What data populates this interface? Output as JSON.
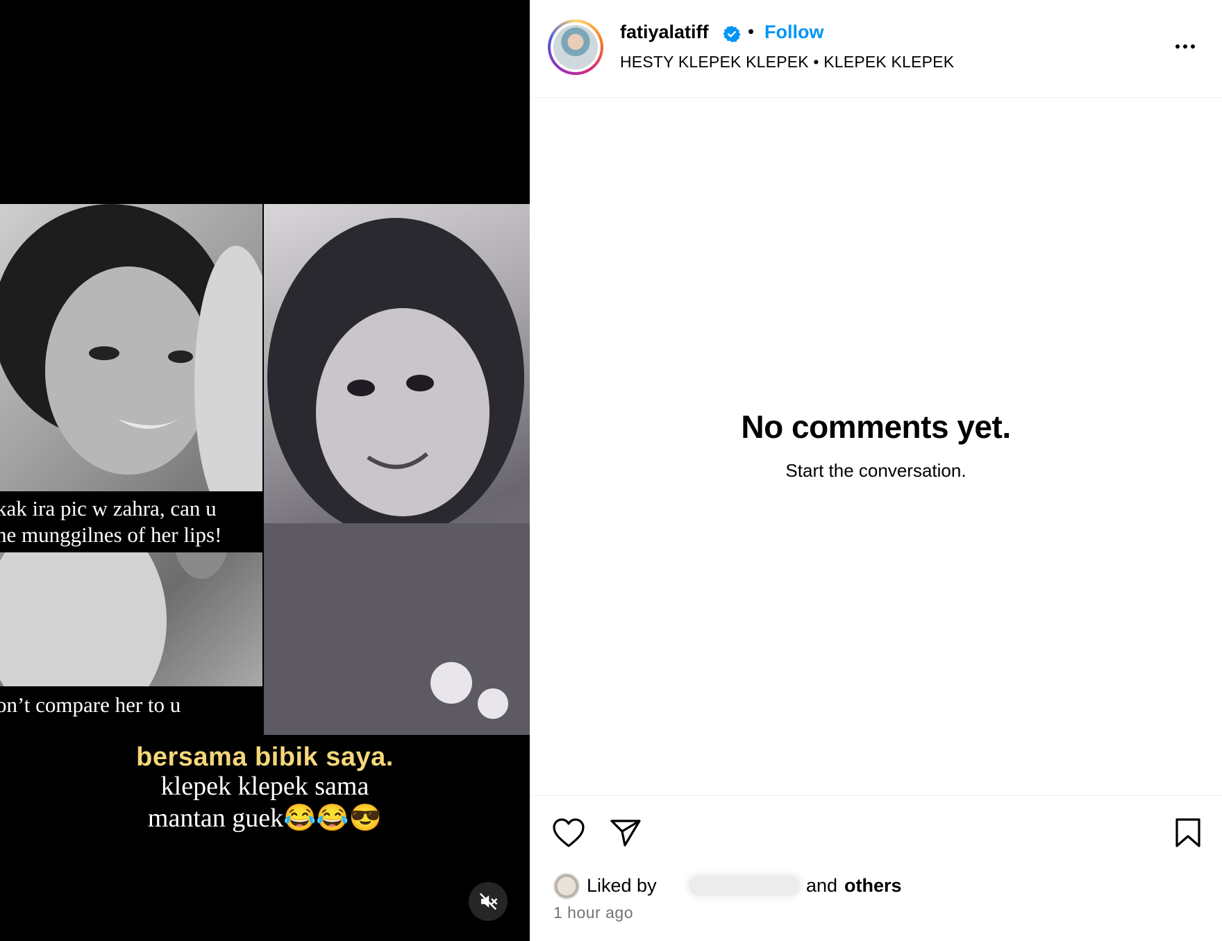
{
  "post": {
    "username": "fatiyalatiff",
    "verified": true,
    "follow_label": "Follow",
    "separator": "•",
    "audio": "HESTY KLEPEK KLEPEK • KLEPEK KLEPEK"
  },
  "media": {
    "caption_left_line1": "kak ira pic w zahra, can u",
    "caption_left_line2": "he munggilnes of her lips!",
    "caption_left_line3": "on’t compare her to u",
    "sticker_yellow": "bersama  bibik saya.",
    "sticker_white_line1": "klepek klepek sama",
    "sticker_white_line2": "mantan guek😂😂😎",
    "muted": true
  },
  "comments": {
    "empty_title": "No comments yet.",
    "empty_subtitle": "Start the conversation."
  },
  "footer": {
    "liked_by": "Liked by",
    "and": "and",
    "others": "others",
    "timestamp": "1 hour ago"
  },
  "colors": {
    "accent": "#0095f6",
    "muted_text": "#737373",
    "divider": "#efefef"
  },
  "icons": [
    "verified-badge-icon",
    "more-options-icon",
    "heart-icon",
    "share-icon",
    "bookmark-icon",
    "speaker-muted-icon"
  ]
}
